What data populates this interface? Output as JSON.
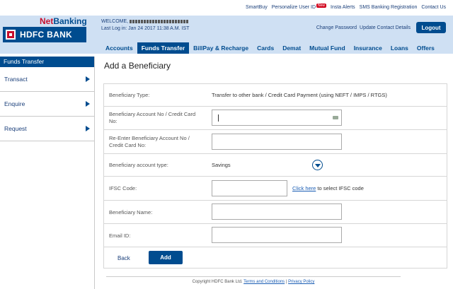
{
  "util_links": [
    "SmartBuy",
    "Personalize User ID",
    "Insta Alerts",
    "SMS Banking Registration",
    "Contact Us"
  ],
  "util_new_badge": "New",
  "brand": {
    "netbanking_net": "Net",
    "netbanking_banking": "Banking",
    "bank_name": "HDFC BANK"
  },
  "welcome": {
    "label": "WELCOME,",
    "last_login": "Last Log in: Jan 24 2017 11:38 A.M. IST"
  },
  "header_links": {
    "change_password": "Change Password",
    "update_contact": "Update Contact Details",
    "logout": "Logout"
  },
  "nav_tabs": [
    "Accounts",
    "Funds Transfer",
    "BillPay & Recharge",
    "Cards",
    "Demat",
    "Mutual Fund",
    "Insurance",
    "Loans",
    "Offers"
  ],
  "nav_active": "Funds Transfer",
  "sidebar": {
    "title": "Funds Transfer",
    "items": [
      "Transact",
      "Enquire",
      "Request"
    ]
  },
  "page_title": "Add a Beneficiary",
  "form": {
    "beneficiary_type_label": "Beneficiary Type:",
    "beneficiary_type_value": "Transfer to other bank / Credit Card Payment (using NEFT / IMPS / RTGS)",
    "account_no_label": "Beneficiary Account No / Credit Card No:",
    "account_no_value": "",
    "reenter_label": "Re-Enter Beneficiary Account No / Credit Card No:",
    "reenter_value": "",
    "account_type_label": "Beneficiary account type:",
    "account_type_value": "Savings",
    "ifsc_label": "IFSC Code:",
    "ifsc_value": "",
    "ifsc_link": "Click here",
    "ifsc_link_suffix": " to select IFSC code",
    "name_label": "Beneficiary Name:",
    "name_value": "",
    "email_label": "Email ID:",
    "email_value": "",
    "back_label": "Back",
    "add_label": "Add"
  },
  "footer": {
    "copyright": "Copyright HDFC Bank Ltd. ",
    "terms": "Terms and Conditions",
    "sep": " | ",
    "privacy": "Privacy Policy"
  },
  "colors": {
    "primary": "#004c8f",
    "header_bg": "#cfe0f3",
    "brand_red": "#c8102e"
  }
}
